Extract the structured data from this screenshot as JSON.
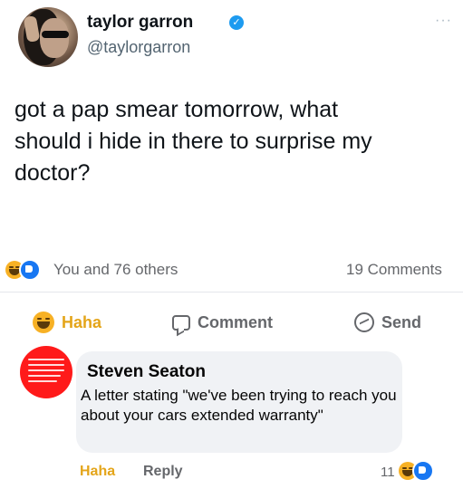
{
  "tweet": {
    "display_name": "taylor garron",
    "handle": "@taylorgarron",
    "more_label": "···",
    "verified_mark": "✓",
    "text": "got a pap smear tomorrow, what\nshould i hide in there to surprise my\ndoctor?"
  },
  "reactions": {
    "icons": [
      "haha-emoji-icon",
      "like-icon"
    ],
    "others_label": "You and 76 others",
    "comments_count_label": "19 Comments"
  },
  "actions": {
    "haha_label": "Haha",
    "comment_label": "Comment",
    "send_label": "Send"
  },
  "comment": {
    "author": "Steven Seaton",
    "text": "A letter stating \"we've been trying to reach you about your cars extended warranty\"",
    "haha_label": "Haha",
    "reply_label": "Reply",
    "reaction_count": "11"
  },
  "colors": {
    "haha": "#e4a51a",
    "like": "#1877f2",
    "verified": "#1d9bf0",
    "commenter_avatar": "#ff1a1a",
    "bubble": "#f0f2f5"
  }
}
